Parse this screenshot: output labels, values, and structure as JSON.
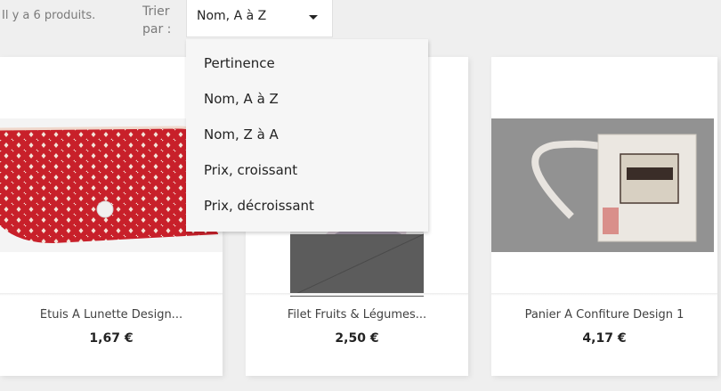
{
  "toolbar": {
    "product_count": "Il y a 6 produits.",
    "sort_label": "Trier par :",
    "sort_selected": "Nom, A à Z"
  },
  "sort_options": [
    "Pertinence",
    "Nom, A à Z",
    "Nom, Z à A",
    "Prix, croissant",
    "Prix, décroissant"
  ],
  "products": [
    {
      "title": "Étuis À Lunette Design...",
      "price": "1,67 €"
    },
    {
      "title": "Filet Fruits & Légumes...",
      "price": "2,50 €"
    },
    {
      "title": "Panier À Confiture Design 1",
      "price": "4,17 €"
    }
  ],
  "colors": {
    "page_bg": "#efefef",
    "card_bg": "#ffffff",
    "dropdown_bg": "#f6f6f6",
    "muted_text": "#7a7a7a"
  },
  "icons": {
    "sort_caret": "caret-down-icon"
  }
}
